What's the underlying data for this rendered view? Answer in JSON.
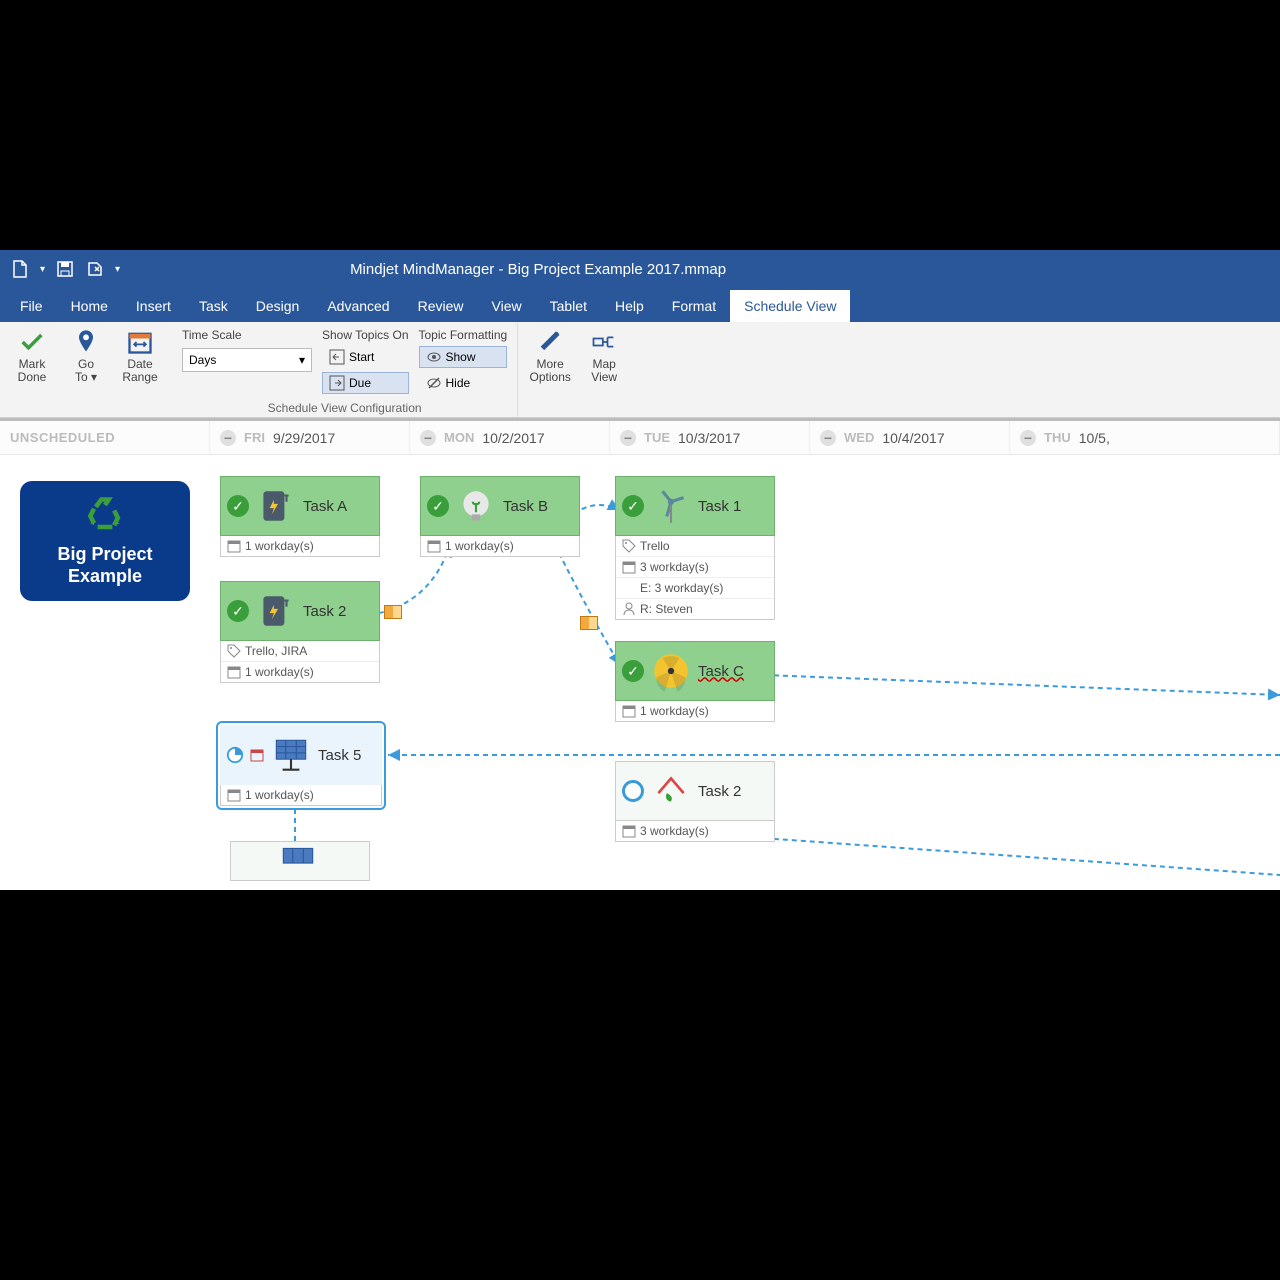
{
  "title": "Mindjet MindManager - Big Project Example 2017.mmap",
  "tabs": [
    "File",
    "Home",
    "Insert",
    "Task",
    "Design",
    "Advanced",
    "Review",
    "View",
    "Tablet",
    "Help",
    "Format",
    "Schedule View"
  ],
  "active_tab": "Schedule View",
  "ribbon": {
    "mark_done": "Mark\nDone",
    "go_to": "Go\nTo",
    "date_range": "Date\nRange",
    "time_scale_label": "Time Scale",
    "time_scale_value": "Days",
    "show_topics_on_label": "Show Topics On",
    "start": "Start",
    "due": "Due",
    "topic_formatting_label": "Topic Formatting",
    "show": "Show",
    "hide": "Hide",
    "more_options": "More\nOptions",
    "map_view": "Map\nView",
    "group_config": "Schedule View Configuration"
  },
  "columns": {
    "unscheduled": "UNSCHEDULED",
    "fri": {
      "dow": "FRI",
      "date": "9/29/2017"
    },
    "mon": {
      "dow": "MON",
      "date": "10/2/2017"
    },
    "tue": {
      "dow": "TUE",
      "date": "10/3/2017"
    },
    "wed": {
      "dow": "WED",
      "date": "10/4/2017"
    },
    "thu": {
      "dow": "THU",
      "date": "10/5,"
    }
  },
  "project": {
    "title": "Big Project Example"
  },
  "tasks": {
    "a": {
      "name": "Task A",
      "meta1": "1 workday(s)"
    },
    "t2": {
      "name": "Task 2",
      "tags": "Trello, JIRA",
      "meta1": "1 workday(s)"
    },
    "t5": {
      "name": "Task 5",
      "meta1": "1 workday(s)"
    },
    "b": {
      "name": "Task B",
      "meta1": "1 workday(s)"
    },
    "t1": {
      "name": "Task 1",
      "tags": "Trello",
      "meta1": "3 workday(s)",
      "meta2": "E: 3 workday(s)",
      "meta3": "R: Steven"
    },
    "c": {
      "name": "Task C",
      "meta1": "1 workday(s)"
    },
    "t2b": {
      "name": "Task 2",
      "meta1": "3 workday(s)"
    }
  }
}
